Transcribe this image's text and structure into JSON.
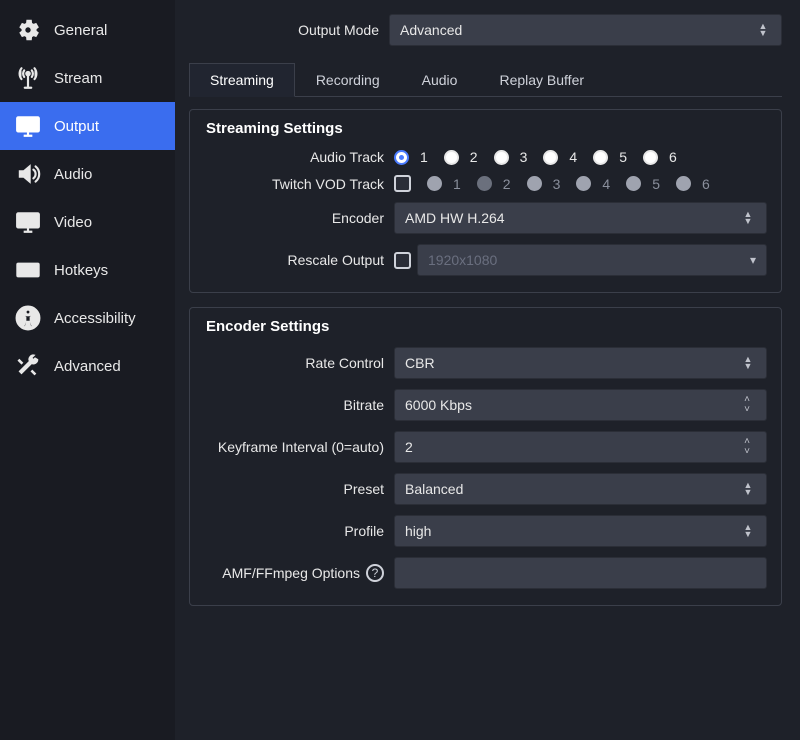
{
  "sidebar": {
    "items": [
      {
        "id": "general",
        "label": "General"
      },
      {
        "id": "stream",
        "label": "Stream"
      },
      {
        "id": "output",
        "label": "Output"
      },
      {
        "id": "audio",
        "label": "Audio"
      },
      {
        "id": "video",
        "label": "Video"
      },
      {
        "id": "hotkeys",
        "label": "Hotkeys"
      },
      {
        "id": "accessibility",
        "label": "Accessibility"
      },
      {
        "id": "advanced",
        "label": "Advanced"
      }
    ]
  },
  "output_mode": {
    "label": "Output Mode",
    "value": "Advanced"
  },
  "tabs": {
    "streaming": "Streaming",
    "recording": "Recording",
    "audio": "Audio",
    "replay": "Replay Buffer"
  },
  "streaming_settings": {
    "title": "Streaming Settings",
    "audio_track": {
      "label": "Audio Track",
      "selected": 1,
      "options": [
        "1",
        "2",
        "3",
        "4",
        "5",
        "6"
      ]
    },
    "twitch_vod": {
      "label": "Twitch VOD Track",
      "enabled": false,
      "selected": 2,
      "options": [
        "1",
        "2",
        "3",
        "4",
        "5",
        "6"
      ]
    },
    "encoder": {
      "label": "Encoder",
      "value": "AMD HW H.264"
    },
    "rescale": {
      "label": "Rescale Output",
      "enabled": false,
      "value": "1920x1080"
    }
  },
  "encoder_settings": {
    "title": "Encoder Settings",
    "rate_control": {
      "label": "Rate Control",
      "value": "CBR"
    },
    "bitrate": {
      "label": "Bitrate",
      "value": "6000 Kbps"
    },
    "keyframe": {
      "label": "Keyframe Interval (0=auto)",
      "value": "2"
    },
    "preset": {
      "label": "Preset",
      "value": "Balanced"
    },
    "profile": {
      "label": "Profile",
      "value": "high"
    },
    "amf": {
      "label": "AMF/FFmpeg Options",
      "value": ""
    }
  }
}
